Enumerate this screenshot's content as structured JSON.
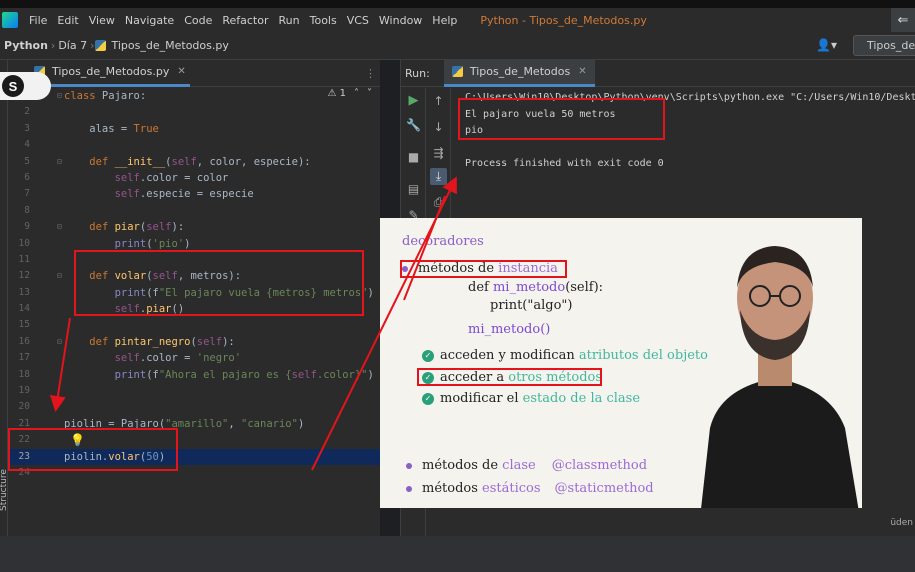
{
  "menubar": {
    "items": [
      "File",
      "Edit",
      "View",
      "Navigate",
      "Code",
      "Refactor",
      "Run",
      "Tools",
      "VCS",
      "Window",
      "Help"
    ],
    "title": "Python - Tipos_de_Metodos.py"
  },
  "navbar": {
    "project": "Python",
    "folder": "Día 7",
    "file": "Tipos_de_Metodos.py",
    "run_config": "Tipos_de"
  },
  "editor": {
    "tab_label": "Tipos_de_Metodos.py",
    "warning_count": "1",
    "current_line": 23,
    "lines": [
      {
        "n": "1",
        "text": "class Pajaro:"
      },
      {
        "n": "2",
        "text": ""
      },
      {
        "n": "3",
        "text": "    alas = True"
      },
      {
        "n": "4",
        "text": ""
      },
      {
        "n": "5",
        "text": "    def __init__(self, color, especie):"
      },
      {
        "n": "6",
        "text": "        self.color = color"
      },
      {
        "n": "7",
        "text": "        self.especie = especie"
      },
      {
        "n": "8",
        "text": ""
      },
      {
        "n": "9",
        "text": "    def piar(self):"
      },
      {
        "n": "10",
        "text": "        print('pio')"
      },
      {
        "n": "11",
        "text": ""
      },
      {
        "n": "12",
        "text": "    def volar(self, metros):"
      },
      {
        "n": "13",
        "text": "        print(f\"El pajaro vuela {metros} metros\")"
      },
      {
        "n": "14",
        "text": "        self.piar()"
      },
      {
        "n": "15",
        "text": ""
      },
      {
        "n": "16",
        "text": "    def pintar_negro(self):"
      },
      {
        "n": "17",
        "text": "        self.color = 'negro'"
      },
      {
        "n": "18",
        "text": "        print(f\"Ahora el pajaro es {self.color}\")"
      },
      {
        "n": "19",
        "text": ""
      },
      {
        "n": "20",
        "text": ""
      },
      {
        "n": "21",
        "text": "piolin = Pajaro(\"amarillo\", \"canario\")"
      },
      {
        "n": "22",
        "text": ""
      },
      {
        "n": "23",
        "text": "piolin.volar(50)"
      },
      {
        "n": "24",
        "text": ""
      }
    ],
    "structure_label": "Structure"
  },
  "run_panel": {
    "label": "Run:",
    "tab": "Tipos_de_Metodos",
    "console": [
      "C:\\Users\\Win10\\Desktop\\Python\\venv\\Scripts\\python.exe \"C:/Users/Win10/Deskto",
      "El pajaro vuela 50 metros",
      "pio",
      "",
      "Process finished with exit code 0"
    ]
  },
  "badge": {
    "letter": "S"
  },
  "slide": {
    "title": "decoradores",
    "instance_prefix": "métodos de ",
    "instance_word": "instancia",
    "def_line": "def mi_metodo(self):",
    "def_kw": "def ",
    "def_name": "mi_metodo",
    "def_rest": "(self):",
    "print_line": "print(\"algo\")",
    "call": "mi_metodo()",
    "check1_a": "acceden y modifican ",
    "check1_b": "atributos del objeto",
    "check2_a": "acceder a ",
    "check2_b": "otros métodos",
    "check3_a": "modificar el ",
    "check3_b": "estado de la clase",
    "class_a": "métodos de ",
    "class_b": "clase",
    "class_dec": "@classmethod",
    "static_a": "métodos ",
    "static_b": "estáticos",
    "static_dec": "@staticmethod"
  },
  "watermark": "üden",
  "colors": {
    "annotation": "#e3141b",
    "keyword": "#cc7832",
    "function": "#ffc66d",
    "string": "#6a8759",
    "number": "#6897bb",
    "slide_accent": "#8a5fc7"
  }
}
